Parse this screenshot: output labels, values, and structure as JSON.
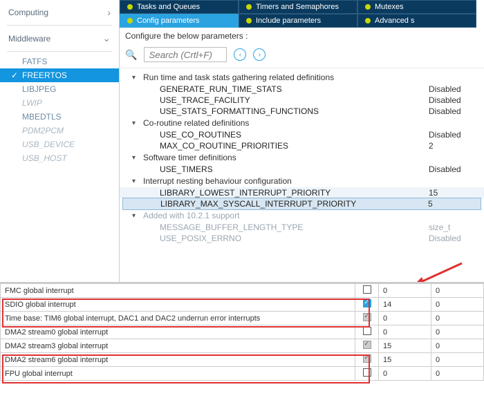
{
  "sidebar": {
    "categories": [
      {
        "label": "Computing",
        "expanded": false
      },
      {
        "label": "Middleware",
        "expanded": true
      }
    ],
    "items": [
      {
        "label": "FATFS",
        "dim": false
      },
      {
        "label": "FREERTOS",
        "active": true
      },
      {
        "label": "LIBJPEG",
        "dim": false
      },
      {
        "label": "LWIP",
        "dim": true
      },
      {
        "label": "MBEDTLS",
        "dim": false
      },
      {
        "label": "PDM2PCM",
        "dim": true
      },
      {
        "label": "USB_DEVICE",
        "dim": true
      },
      {
        "label": "USB_HOST",
        "dim": true
      }
    ]
  },
  "tabs": [
    {
      "label": "Tasks and Queues"
    },
    {
      "label": "Timers and Semaphores"
    },
    {
      "label": "Mutexes"
    },
    {
      "label": "Config parameters",
      "active": true
    },
    {
      "label": "Include parameters"
    },
    {
      "label": "Advanced s"
    }
  ],
  "config_heading": "Configure the below parameters :",
  "search": {
    "placeholder": "Search (Crtl+F)"
  },
  "tree": [
    {
      "title": "Run time and task stats gathering related definitions",
      "rows": [
        {
          "label": "GENERATE_RUN_TIME_STATS",
          "value": "Disabled"
        },
        {
          "label": "USE_TRACE_FACILITY",
          "value": "Disabled"
        },
        {
          "label": "USE_STATS_FORMATTING_FUNCTIONS",
          "value": "Disabled"
        }
      ]
    },
    {
      "title": "Co-routine related definitions",
      "rows": [
        {
          "label": "USE_CO_ROUTINES",
          "value": "Disabled"
        },
        {
          "label": "MAX_CO_ROUTINE_PRIORITIES",
          "value": "2"
        }
      ]
    },
    {
      "title": "Software timer definitions",
      "rows": [
        {
          "label": "USE_TIMERS",
          "value": "Disabled"
        }
      ]
    },
    {
      "title": "Interrupt nesting behaviour configuration",
      "rows": [
        {
          "label": "LIBRARY_LOWEST_INTERRUPT_PRIORITY",
          "value": "15",
          "light": true
        },
        {
          "label": "LIBRARY_MAX_SYSCALL_INTERRUPT_PRIORITY",
          "value": "5",
          "selected": true
        }
      ]
    },
    {
      "title": "Added with 10.2.1 support",
      "dim": true,
      "rows": [
        {
          "label": "MESSAGE_BUFFER_LENGTH_TYPE",
          "value": "size_t",
          "dim": true
        },
        {
          "label": "USE_POSIX_ERRNO",
          "value": "Disabled",
          "dim": true
        }
      ]
    }
  ],
  "bottom": {
    "rows": [
      {
        "name": "FMC global interrupt",
        "ck": "unchecked",
        "prio": "0",
        "sub": "0"
      },
      {
        "name": "SDIO global interrupt",
        "ck": "checked",
        "prio": "14",
        "sub": "0"
      },
      {
        "name": "Time base: TIM6 global interrupt, DAC1 and DAC2 underrun error interrupts",
        "ck": "gray-checked",
        "prio": "0",
        "sub": "0"
      },
      {
        "name": "DMA2 stream0 global interrupt",
        "ck": "unchecked",
        "prio": "0",
        "sub": "0"
      },
      {
        "name": "DMA2 stream3 global interrupt",
        "ck": "gray-checked",
        "prio": "15",
        "sub": "0"
      },
      {
        "name": "DMA2 stream6 global interrupt",
        "ck": "gray-checked",
        "prio": "15",
        "sub": "0"
      },
      {
        "name": "FPU global interrupt",
        "ck": "unchecked",
        "prio": "0",
        "sub": "0"
      }
    ]
  }
}
